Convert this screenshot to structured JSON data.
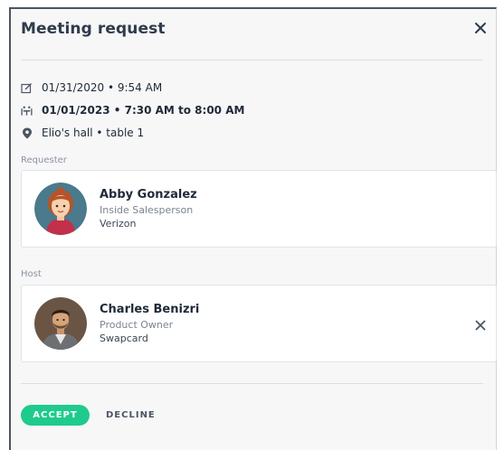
{
  "modal": {
    "title": "Meeting request",
    "close_icon": "close-icon"
  },
  "details": {
    "requested_date": "01/31/2020 • 9:54 AM",
    "meeting_time": "01/01/2023 • 7:30 AM to 8:00 AM",
    "location": "Elio's hall • table 1",
    "icons": {
      "requested": "edit-calendar-icon",
      "meeting": "meeting-table-icon",
      "location": "location-pin-icon"
    }
  },
  "requester": {
    "label": "Requester",
    "name": "Abby Gonzalez",
    "job_title": "Inside Salesperson",
    "company": "Verizon"
  },
  "host": {
    "label": "Host",
    "name": "Charles Benizri",
    "job_title": "Product Owner",
    "company": "Swapcard",
    "remove_icon": "close-icon"
  },
  "actions": {
    "accept_label": "ACCEPT",
    "decline_label": "DECLINE"
  },
  "colors": {
    "accept": "#1ecb8c",
    "title": "#2f3b4a",
    "muted": "#8a93a0"
  }
}
